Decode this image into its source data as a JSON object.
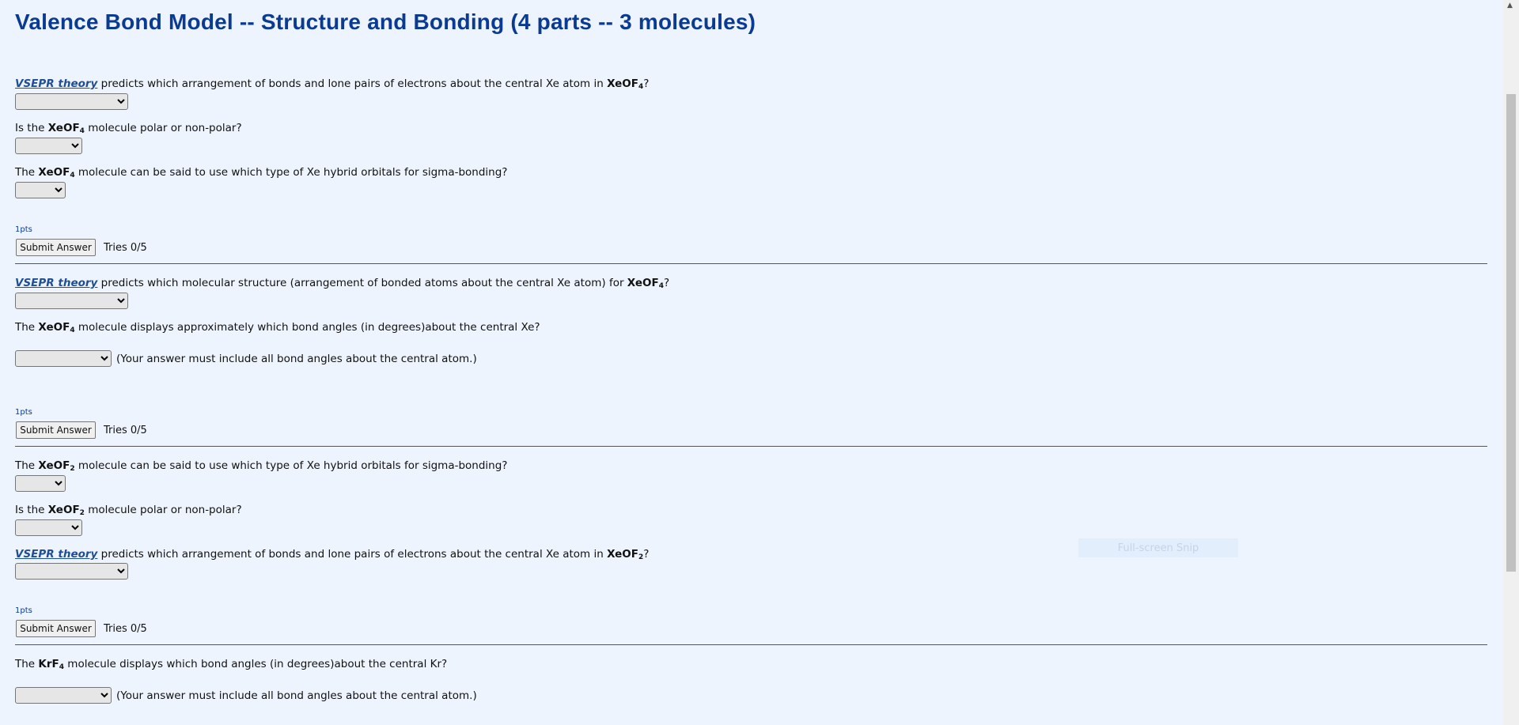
{
  "page_title": "Valence Bond Model -- Structure and Bonding (4 parts -- 3 molecules)",
  "link_text": "VSEPR theory",
  "parts": [
    {
      "questions": {
        "q1": {
          "pre": " predicts which arrangement of bonds and lone pairs of electrons about the central Xe atom in ",
          "mol": "XeOF",
          "sub": "4",
          "post": "?"
        },
        "q2": {
          "pre": "Is the ",
          "mol": "XeOF",
          "sub": "4",
          "post": " molecule polar or non-polar?"
        },
        "q3": {
          "pre": "The ",
          "mol": "XeOF",
          "sub": "4",
          "post": " molecule can be said to use which type of Xe hybrid orbitals for sigma-bonding?"
        }
      },
      "points": "1pts",
      "submit_label": "Submit Answer",
      "tries": "Tries 0/5"
    },
    {
      "questions": {
        "q1": {
          "pre": " predicts which molecular structure (arrangement of bonded atoms about the central Xe atom) for ",
          "mol": "XeOF",
          "sub": "4",
          "post": "?"
        },
        "q2": {
          "pre": "The ",
          "mol": "XeOF",
          "sub": "4",
          "post": " molecule displays approximately which bond angles (in degrees)about the central Xe?"
        }
      },
      "note": "(Your answer must include all bond angles about the central atom.)",
      "points": "1pts",
      "submit_label": "Submit Answer",
      "tries": "Tries 0/5"
    },
    {
      "questions": {
        "q1": {
          "pre": "The ",
          "mol": "XeOF",
          "sub": "2",
          "post": " molecule can be said to use which type of Xe hybrid orbitals for sigma-bonding?"
        },
        "q2": {
          "pre": "Is the ",
          "mol": "XeOF",
          "sub": "2",
          "post": " molecule polar or non-polar?"
        },
        "q3": {
          "pre": " predicts which arrangement of bonds and lone pairs of electrons about the central Xe atom in ",
          "mol": "XeOF",
          "sub": "2",
          "post": "?"
        }
      },
      "points": "1pts",
      "submit_label": "Submit Answer",
      "tries": "Tries 0/5"
    },
    {
      "questions": {
        "q1": {
          "pre": "The ",
          "mol": "KrF",
          "sub": "4",
          "post": " molecule displays which bond angles (in degrees)about the central Kr?"
        }
      },
      "note": "(Your answer must include all bond angles about the central atom.)"
    }
  ],
  "overlay": {
    "snip_label": "Full-screen Snip"
  },
  "colors": {
    "background": "#edf4fd",
    "title": "#0b3a93",
    "link": "#1f4e96"
  }
}
